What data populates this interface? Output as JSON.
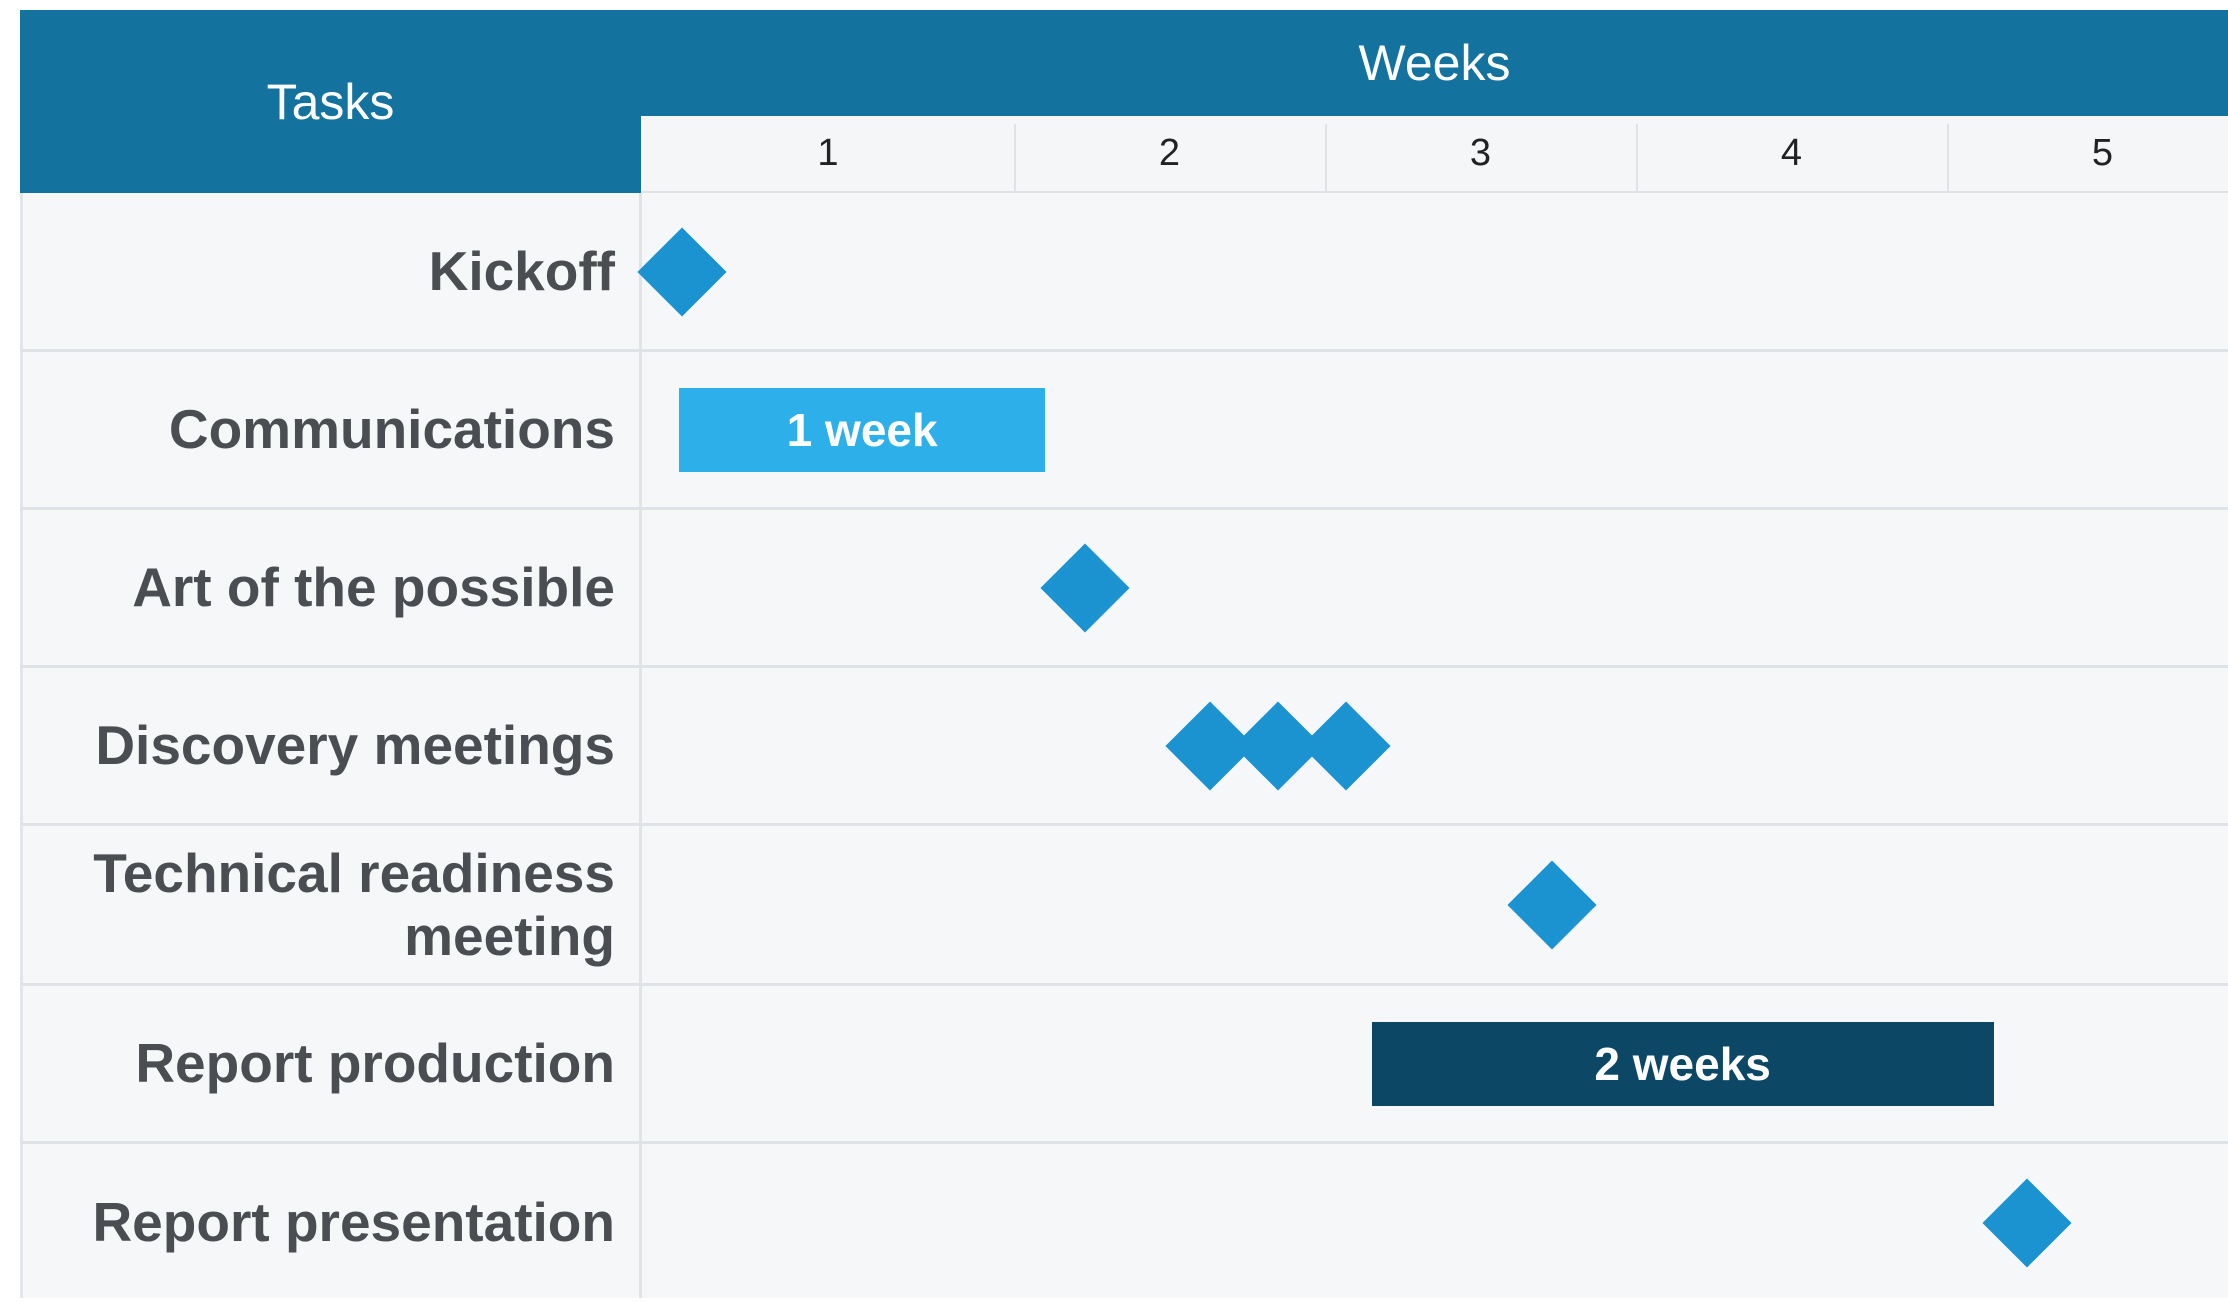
{
  "chart_data": {
    "type": "gantt",
    "tasks_header": "Tasks",
    "weeks_header": "Weeks",
    "weeks": [
      "1",
      "2",
      "3",
      "4",
      "5"
    ],
    "tasks": [
      {
        "name": "Kickoff",
        "milestones": [
          0.0
        ]
      },
      {
        "name": "Communications",
        "bar": {
          "start": 0.1,
          "end": 1.1,
          "label": "1 week",
          "color": "#2db0e9"
        }
      },
      {
        "name": "Art of the possible",
        "milestones": [
          1.1
        ]
      },
      {
        "name": "Discovery meetings",
        "milestones": [
          1.5,
          1.72,
          1.94
        ]
      },
      {
        "name": "Technical readiness meeting",
        "milestones": [
          2.6
        ]
      },
      {
        "name": "Report production",
        "bar": {
          "start": 2.15,
          "end": 4.15,
          "label": "2 weeks",
          "color": "#0c4866"
        }
      },
      {
        "name": "Report presentation",
        "milestones": [
          4.13
        ]
      }
    ],
    "colors": {
      "header": "#13729e",
      "milestone": "#1b93d1",
      "background": "#f5f7f9"
    }
  }
}
